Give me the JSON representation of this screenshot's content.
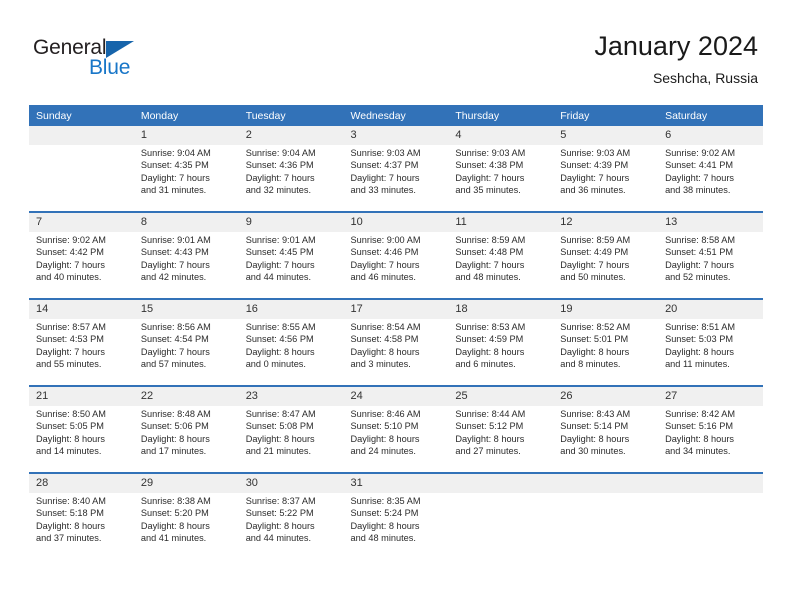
{
  "brand": {
    "name_dark": "General",
    "name_blue": "Blue",
    "triangle_color": "#1664ab",
    "blue_color": "#1876c8"
  },
  "header": {
    "title": "January 2024",
    "subtitle": "Seshcha, Russia"
  },
  "theme": {
    "header_blue": "#3272b8",
    "daynum_band": "#f0f0f0",
    "text": "#2b2b2b"
  },
  "weekday_headers": [
    "Sunday",
    "Monday",
    "Tuesday",
    "Wednesday",
    "Thursday",
    "Friday",
    "Saturday"
  ],
  "weeks": [
    {
      "days": [
        {
          "num": "",
          "lines": []
        },
        {
          "num": "1",
          "lines": [
            "Sunrise: 9:04 AM",
            "Sunset: 4:35 PM",
            "Daylight: 7 hours",
            "and 31 minutes."
          ]
        },
        {
          "num": "2",
          "lines": [
            "Sunrise: 9:04 AM",
            "Sunset: 4:36 PM",
            "Daylight: 7 hours",
            "and 32 minutes."
          ]
        },
        {
          "num": "3",
          "lines": [
            "Sunrise: 9:03 AM",
            "Sunset: 4:37 PM",
            "Daylight: 7 hours",
            "and 33 minutes."
          ]
        },
        {
          "num": "4",
          "lines": [
            "Sunrise: 9:03 AM",
            "Sunset: 4:38 PM",
            "Daylight: 7 hours",
            "and 35 minutes."
          ]
        },
        {
          "num": "5",
          "lines": [
            "Sunrise: 9:03 AM",
            "Sunset: 4:39 PM",
            "Daylight: 7 hours",
            "and 36 minutes."
          ]
        },
        {
          "num": "6",
          "lines": [
            "Sunrise: 9:02 AM",
            "Sunset: 4:41 PM",
            "Daylight: 7 hours",
            "and 38 minutes."
          ]
        }
      ]
    },
    {
      "days": [
        {
          "num": "7",
          "lines": [
            "Sunrise: 9:02 AM",
            "Sunset: 4:42 PM",
            "Daylight: 7 hours",
            "and 40 minutes."
          ]
        },
        {
          "num": "8",
          "lines": [
            "Sunrise: 9:01 AM",
            "Sunset: 4:43 PM",
            "Daylight: 7 hours",
            "and 42 minutes."
          ]
        },
        {
          "num": "9",
          "lines": [
            "Sunrise: 9:01 AM",
            "Sunset: 4:45 PM",
            "Daylight: 7 hours",
            "and 44 minutes."
          ]
        },
        {
          "num": "10",
          "lines": [
            "Sunrise: 9:00 AM",
            "Sunset: 4:46 PM",
            "Daylight: 7 hours",
            "and 46 minutes."
          ]
        },
        {
          "num": "11",
          "lines": [
            "Sunrise: 8:59 AM",
            "Sunset: 4:48 PM",
            "Daylight: 7 hours",
            "and 48 minutes."
          ]
        },
        {
          "num": "12",
          "lines": [
            "Sunrise: 8:59 AM",
            "Sunset: 4:49 PM",
            "Daylight: 7 hours",
            "and 50 minutes."
          ]
        },
        {
          "num": "13",
          "lines": [
            "Sunrise: 8:58 AM",
            "Sunset: 4:51 PM",
            "Daylight: 7 hours",
            "and 52 minutes."
          ]
        }
      ]
    },
    {
      "days": [
        {
          "num": "14",
          "lines": [
            "Sunrise: 8:57 AM",
            "Sunset: 4:53 PM",
            "Daylight: 7 hours",
            "and 55 minutes."
          ]
        },
        {
          "num": "15",
          "lines": [
            "Sunrise: 8:56 AM",
            "Sunset: 4:54 PM",
            "Daylight: 7 hours",
            "and 57 minutes."
          ]
        },
        {
          "num": "16",
          "lines": [
            "Sunrise: 8:55 AM",
            "Sunset: 4:56 PM",
            "Daylight: 8 hours",
            "and 0 minutes."
          ]
        },
        {
          "num": "17",
          "lines": [
            "Sunrise: 8:54 AM",
            "Sunset: 4:58 PM",
            "Daylight: 8 hours",
            "and 3 minutes."
          ]
        },
        {
          "num": "18",
          "lines": [
            "Sunrise: 8:53 AM",
            "Sunset: 4:59 PM",
            "Daylight: 8 hours",
            "and 6 minutes."
          ]
        },
        {
          "num": "19",
          "lines": [
            "Sunrise: 8:52 AM",
            "Sunset: 5:01 PM",
            "Daylight: 8 hours",
            "and 8 minutes."
          ]
        },
        {
          "num": "20",
          "lines": [
            "Sunrise: 8:51 AM",
            "Sunset: 5:03 PM",
            "Daylight: 8 hours",
            "and 11 minutes."
          ]
        }
      ]
    },
    {
      "days": [
        {
          "num": "21",
          "lines": [
            "Sunrise: 8:50 AM",
            "Sunset: 5:05 PM",
            "Daylight: 8 hours",
            "and 14 minutes."
          ]
        },
        {
          "num": "22",
          "lines": [
            "Sunrise: 8:48 AM",
            "Sunset: 5:06 PM",
            "Daylight: 8 hours",
            "and 17 minutes."
          ]
        },
        {
          "num": "23",
          "lines": [
            "Sunrise: 8:47 AM",
            "Sunset: 5:08 PM",
            "Daylight: 8 hours",
            "and 21 minutes."
          ]
        },
        {
          "num": "24",
          "lines": [
            "Sunrise: 8:46 AM",
            "Sunset: 5:10 PM",
            "Daylight: 8 hours",
            "and 24 minutes."
          ]
        },
        {
          "num": "25",
          "lines": [
            "Sunrise: 8:44 AM",
            "Sunset: 5:12 PM",
            "Daylight: 8 hours",
            "and 27 minutes."
          ]
        },
        {
          "num": "26",
          "lines": [
            "Sunrise: 8:43 AM",
            "Sunset: 5:14 PM",
            "Daylight: 8 hours",
            "and 30 minutes."
          ]
        },
        {
          "num": "27",
          "lines": [
            "Sunrise: 8:42 AM",
            "Sunset: 5:16 PM",
            "Daylight: 8 hours",
            "and 34 minutes."
          ]
        }
      ]
    },
    {
      "days": [
        {
          "num": "28",
          "lines": [
            "Sunrise: 8:40 AM",
            "Sunset: 5:18 PM",
            "Daylight: 8 hours",
            "and 37 minutes."
          ]
        },
        {
          "num": "29",
          "lines": [
            "Sunrise: 8:38 AM",
            "Sunset: 5:20 PM",
            "Daylight: 8 hours",
            "and 41 minutes."
          ]
        },
        {
          "num": "30",
          "lines": [
            "Sunrise: 8:37 AM",
            "Sunset: 5:22 PM",
            "Daylight: 8 hours",
            "and 44 minutes."
          ]
        },
        {
          "num": "31",
          "lines": [
            "Sunrise: 8:35 AM",
            "Sunset: 5:24 PM",
            "Daylight: 8 hours",
            "and 48 minutes."
          ]
        },
        {
          "num": "",
          "lines": []
        },
        {
          "num": "",
          "lines": []
        },
        {
          "num": "",
          "lines": []
        }
      ]
    }
  ]
}
